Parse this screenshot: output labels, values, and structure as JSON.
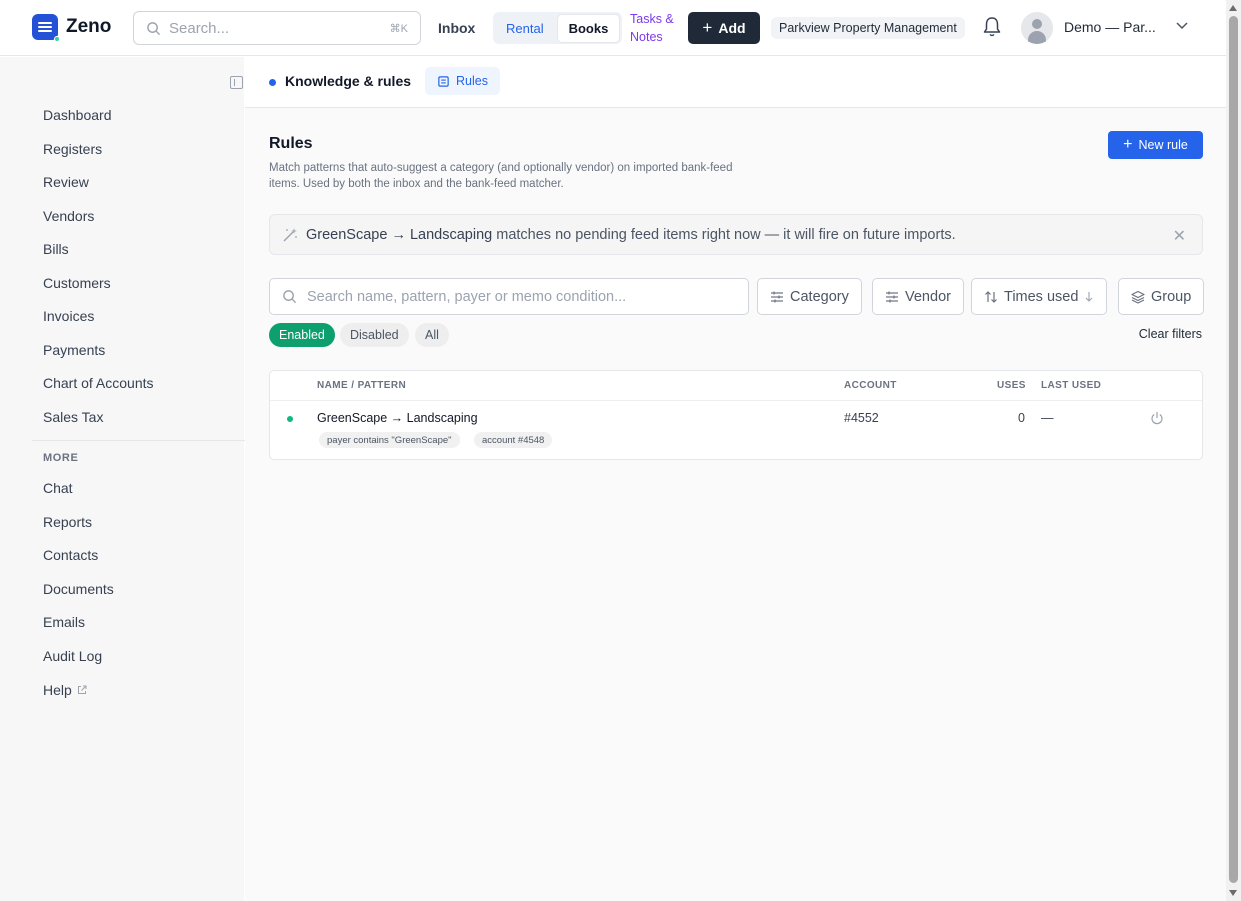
{
  "app": {
    "name": "Zeno"
  },
  "header": {
    "search_placeholder": "Search...",
    "search_shortcut": "⌘K",
    "inbox": "Inbox",
    "tabs": {
      "rental": "Rental",
      "books": "Books"
    },
    "tasks_line1": "Tasks &",
    "tasks_line2": "Notes",
    "add_label": "Add",
    "org": "Parkview Property Management",
    "user": "Demo — Par..."
  },
  "sidebar": {
    "items": [
      "Dashboard",
      "Registers",
      "Review",
      "Vendors",
      "Bills",
      "Customers",
      "Invoices",
      "Payments",
      "Chart of Accounts",
      "Sales Tax"
    ],
    "more_label": "MORE",
    "more_items": [
      "Chat",
      "Reports",
      "Contacts",
      "Documents",
      "Emails",
      "Audit Log",
      "Help"
    ]
  },
  "breadcrumb": {
    "title": "Knowledge & rules",
    "tab": "Rules"
  },
  "page": {
    "title": "Rules",
    "description": "Match patterns that auto-suggest a category (and optionally vendor) on imported bank-feed items. Used by both the inbox and the bank-feed matcher.",
    "new_rule": "New rule"
  },
  "banner": {
    "rule": "GreenScape → Landscaping",
    "message": " matches no pending feed items right now — it will fire on future imports."
  },
  "filters": {
    "search_placeholder": "Search name, pattern, payer or memo condition...",
    "category": "Category",
    "vendor": "Vendor",
    "times_used": "Times used",
    "group": "Group",
    "pills": {
      "enabled": "Enabled",
      "disabled": "Disabled",
      "all": "All"
    },
    "clear": "Clear filters"
  },
  "table": {
    "headers": {
      "name": "NAME / PATTERN",
      "account": "ACCOUNT",
      "uses": "USES",
      "last_used": "LAST USED"
    },
    "rows": [
      {
        "name": "GreenScape → Landscaping",
        "conditions": [
          "payer contains \"GreenScape\"",
          "account #4548"
        ],
        "account": "#4552",
        "uses": "0",
        "last_used": "—",
        "status_color": "#10b981"
      }
    ]
  },
  "colors": {
    "brand": "#2452d6",
    "primary": "#2563eb",
    "enabled": "#0e9f6e",
    "tasks": "#7c3aed"
  }
}
